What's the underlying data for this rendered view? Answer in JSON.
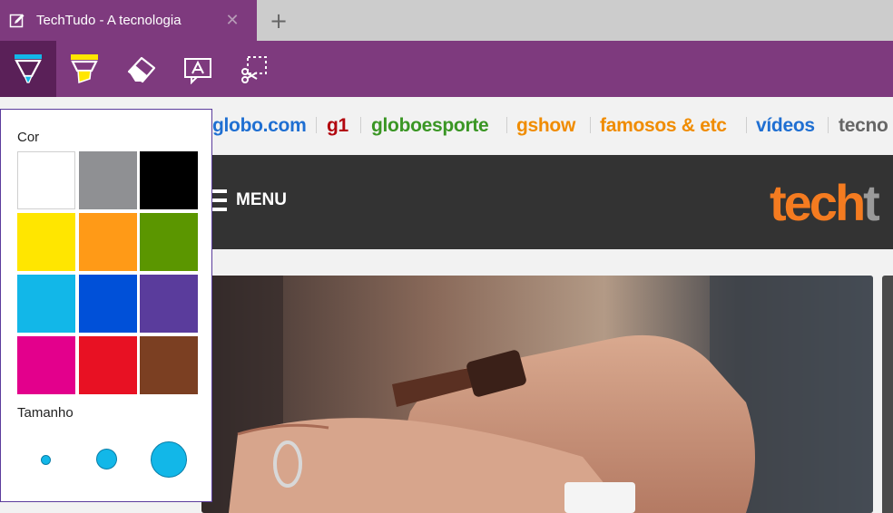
{
  "tab": {
    "title": "TechTudo - A tecnologia",
    "close_glyph": "✕",
    "icon": "edit-page-icon"
  },
  "new_tab_glyph": "+",
  "toolbar": {
    "tools": [
      {
        "name": "ballpoint-pen-icon",
        "active": true
      },
      {
        "name": "highlighter-icon",
        "active": false
      },
      {
        "name": "eraser-icon",
        "active": false
      },
      {
        "name": "add-typed-note-icon",
        "active": false
      },
      {
        "name": "clip-icon",
        "active": false
      }
    ]
  },
  "panel": {
    "color_label": "Cor",
    "size_label": "Tamanho",
    "colors": [
      "#ffffff",
      "#8f9093",
      "#000000",
      "#ffe600",
      "#ff9a17",
      "#5b9600",
      "#12b7e8",
      "#0050d8",
      "#5a3c9c",
      "#e3008c",
      "#e81123",
      "#7b3f22"
    ],
    "sizes": [
      "small",
      "medium",
      "large"
    ]
  },
  "site": {
    "links": [
      {
        "label": "globo.com",
        "color": "#1f6fd2"
      },
      {
        "label": "g1",
        "color": "#b2050e"
      },
      {
        "label": "globoesporte",
        "color": "#3a9624"
      },
      {
        "label": "gshow",
        "color": "#f08c00"
      },
      {
        "label": "famosos & etc",
        "color": "#f08c00"
      },
      {
        "label": "vídeos",
        "color": "#1f6fd2"
      },
      {
        "label": "tecno",
        "color": "#666666"
      }
    ],
    "menu_label": "MENU",
    "logo_main": "tech",
    "logo_tail": "t",
    "logo_color": "#f47b20"
  }
}
